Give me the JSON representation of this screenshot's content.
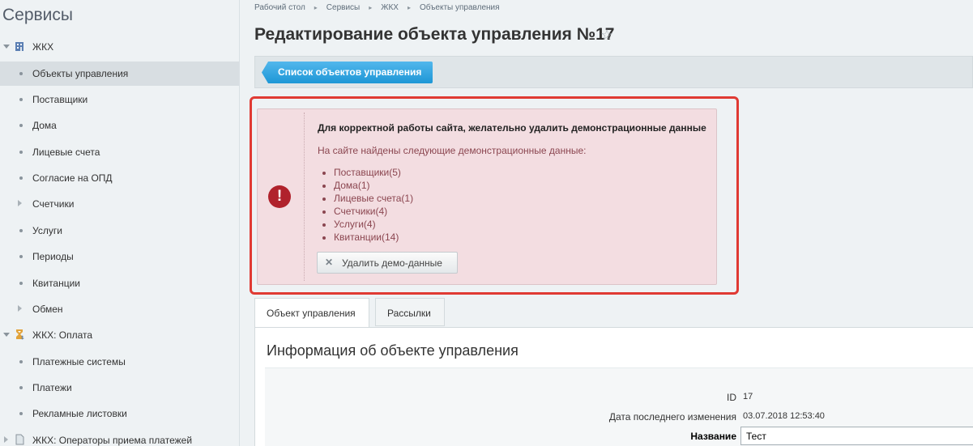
{
  "sidebar": {
    "title": "Сервисы",
    "items": [
      {
        "label": "ЖКХ"
      },
      {
        "label": "Объекты управления"
      },
      {
        "label": "Поставщики"
      },
      {
        "label": "Дома"
      },
      {
        "label": "Лицевые счета"
      },
      {
        "label": "Согласие на ОПД"
      },
      {
        "label": "Счетчики"
      },
      {
        "label": "Услуги"
      },
      {
        "label": "Периоды"
      },
      {
        "label": "Квитанции"
      },
      {
        "label": "Обмен"
      },
      {
        "label": "ЖКХ: Оплата"
      },
      {
        "label": "Платежные системы"
      },
      {
        "label": "Платежи"
      },
      {
        "label": "Рекламные листовки"
      },
      {
        "label": "ЖКХ: Операторы приема платежей"
      }
    ]
  },
  "breadcrumbs": [
    "Рабочий стол",
    "Сервисы",
    "ЖКХ",
    "Объекты управления"
  ],
  "page": {
    "title": "Редактирование объекта управления №17",
    "star_glyph": "☆"
  },
  "toolbar": {
    "list_button": "Список объектов управления"
  },
  "alert": {
    "icon_glyph": "!",
    "heading": "Для корректной работы сайта, желательно удалить демонстрационные данные",
    "subheading": "На сайте найдены следующие демонстрационные данные:",
    "items": [
      "Поставщики(5)",
      "Дома(1)",
      "Лицевые счета(1)",
      "Счетчики(4)",
      "Услуги(4)",
      "Квитанции(14)"
    ],
    "delete_button": "Удалить демо-данные",
    "delete_glyph": "✕",
    "color_frame": "#e03a33",
    "color_icon": "#b0222c"
  },
  "tabs": [
    {
      "label": "Объект управления"
    },
    {
      "label": "Рассылки"
    }
  ],
  "panel": {
    "title": "Информация об объекте управления",
    "fields": {
      "id_label": "ID",
      "id_value": "17",
      "modified_label": "Дата последнего изменения",
      "modified_value": "03.07.2018 12:53:40",
      "name_label": "Название",
      "name_value": "Тест"
    }
  },
  "colors": {
    "accent": "#1d97d6",
    "sidebar_bg": "#eef2f4"
  }
}
